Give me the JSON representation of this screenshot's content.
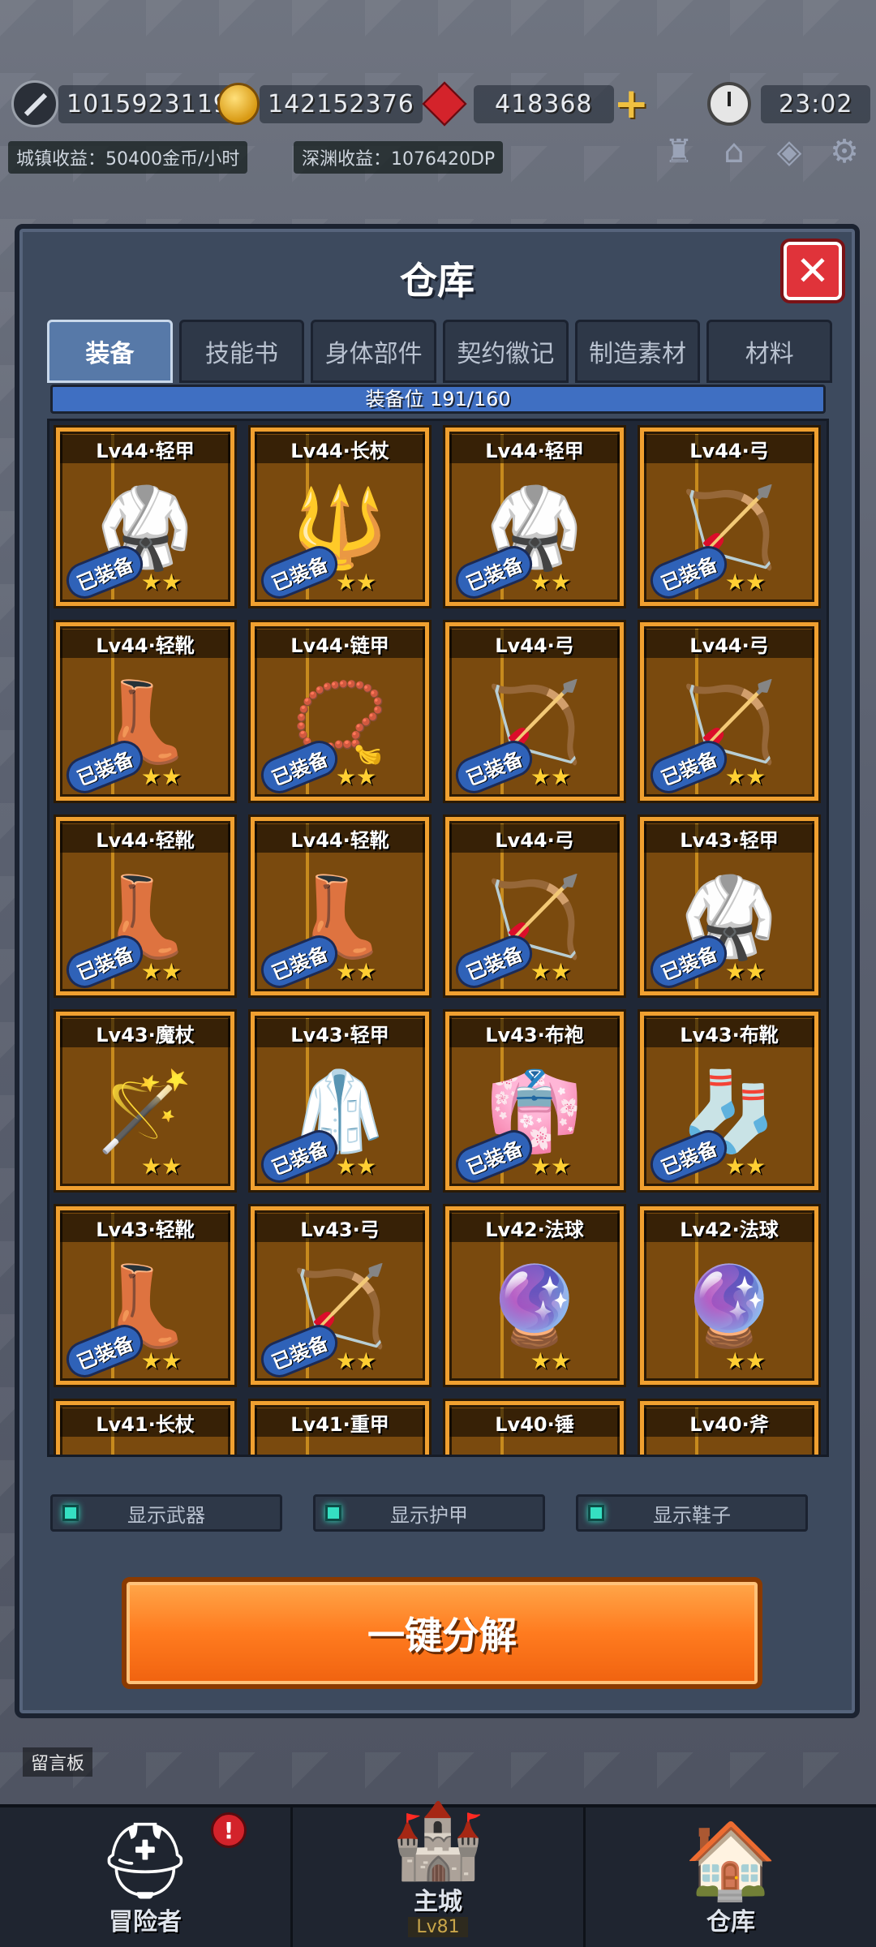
{
  "hud": {
    "power": "1015923119",
    "gold": "142152376",
    "gems": "418368",
    "time": "23:02",
    "town_income": "城镇收益：50400金币/小时",
    "abyss_income": "深渊收益：1076420DP"
  },
  "panel": {
    "title": "仓库",
    "tabs": [
      "装备",
      "技能书",
      "身体部件",
      "契约徽记",
      "制造素材",
      "材料"
    ],
    "active_tab": "装备",
    "slot_text": "装备位 191/160",
    "equipped_badge": "已装备",
    "items": [
      {
        "label": "Lv44·轻甲",
        "icon": "light-armor-icon",
        "glyph": "🥋",
        "equipped": true,
        "stars": 2
      },
      {
        "label": "Lv44·长杖",
        "icon": "long-staff-icon",
        "glyph": "🔱",
        "equipped": true,
        "stars": 2
      },
      {
        "label": "Lv44·轻甲",
        "icon": "light-armor-icon",
        "glyph": "🥋",
        "equipped": true,
        "stars": 2
      },
      {
        "label": "Lv44·弓",
        "icon": "bow-icon",
        "glyph": "🏹",
        "equipped": true,
        "stars": 2
      },
      {
        "label": "Lv44·轻靴",
        "icon": "light-boots-icon",
        "glyph": "👢",
        "equipped": true,
        "stars": 2
      },
      {
        "label": "Lv44·链甲",
        "icon": "chain-armor-icon",
        "glyph": "📿",
        "equipped": true,
        "stars": 2
      },
      {
        "label": "Lv44·弓",
        "icon": "bow-icon",
        "glyph": "🏹",
        "equipped": true,
        "stars": 2
      },
      {
        "label": "Lv44·弓",
        "icon": "bow-icon",
        "glyph": "🏹",
        "equipped": true,
        "stars": 2
      },
      {
        "label": "Lv44·轻靴",
        "icon": "light-boots-icon",
        "glyph": "👢",
        "equipped": true,
        "stars": 2
      },
      {
        "label": "Lv44·轻靴",
        "icon": "light-boots-icon",
        "glyph": "👢",
        "equipped": true,
        "stars": 2
      },
      {
        "label": "Lv44·弓",
        "icon": "bow-icon",
        "glyph": "🏹",
        "equipped": true,
        "stars": 2
      },
      {
        "label": "Lv43·轻甲",
        "icon": "light-armor-icon",
        "glyph": "🥋",
        "equipped": true,
        "stars": 2
      },
      {
        "label": "Lv43·魔杖",
        "icon": "magic-wand-icon",
        "glyph": "🪄",
        "equipped": false,
        "stars": 2
      },
      {
        "label": "Lv43·轻甲",
        "icon": "light-armor-icon",
        "glyph": "🥼",
        "equipped": true,
        "stars": 2
      },
      {
        "label": "Lv43·布袍",
        "icon": "cloth-robe-icon",
        "glyph": "👘",
        "equipped": true,
        "stars": 2
      },
      {
        "label": "Lv43·布靴",
        "icon": "cloth-boots-icon",
        "glyph": "🧦",
        "equipped": true,
        "stars": 2
      },
      {
        "label": "Lv43·轻靴",
        "icon": "light-boots-icon",
        "glyph": "👢",
        "equipped": true,
        "stars": 2
      },
      {
        "label": "Lv43·弓",
        "icon": "bow-icon",
        "glyph": "🏹",
        "equipped": true,
        "stars": 2
      },
      {
        "label": "Lv42·法球",
        "icon": "magic-orb-icon",
        "glyph": "🔮",
        "equipped": false,
        "stars": 2
      },
      {
        "label": "Lv42·法球",
        "icon": "magic-orb-icon",
        "glyph": "🔮",
        "equipped": false,
        "stars": 2
      },
      {
        "label": "Lv41·长杖",
        "icon": "long-staff-icon",
        "glyph": "🔱",
        "equipped": false,
        "stars": 0
      },
      {
        "label": "Lv41·重甲",
        "icon": "heavy-armor-icon",
        "glyph": "🛡",
        "equipped": false,
        "stars": 0
      },
      {
        "label": "Lv40·锤",
        "icon": "hammer-icon",
        "glyph": "🔨",
        "equipped": false,
        "stars": 0
      },
      {
        "label": "Lv40·斧",
        "icon": "axe-icon",
        "glyph": "🪓",
        "equipped": false,
        "stars": 0
      }
    ],
    "filters": [
      "显示武器",
      "显示护甲",
      "显示鞋子"
    ],
    "dismantle_label": "一键分解"
  },
  "board_label": "留言板",
  "nav": {
    "adventurer": "冒险者",
    "main_city": "主城",
    "main_city_level": "Lv81",
    "warehouse": "仓库",
    "alert": "!"
  },
  "colors": {
    "panel_bg": "#3d4a5e",
    "item_border": "#f0a030",
    "equipped_badge": "#2f62b8",
    "dismantle_button": "#ff7b1f",
    "filter_dot": "#35e0c2"
  }
}
